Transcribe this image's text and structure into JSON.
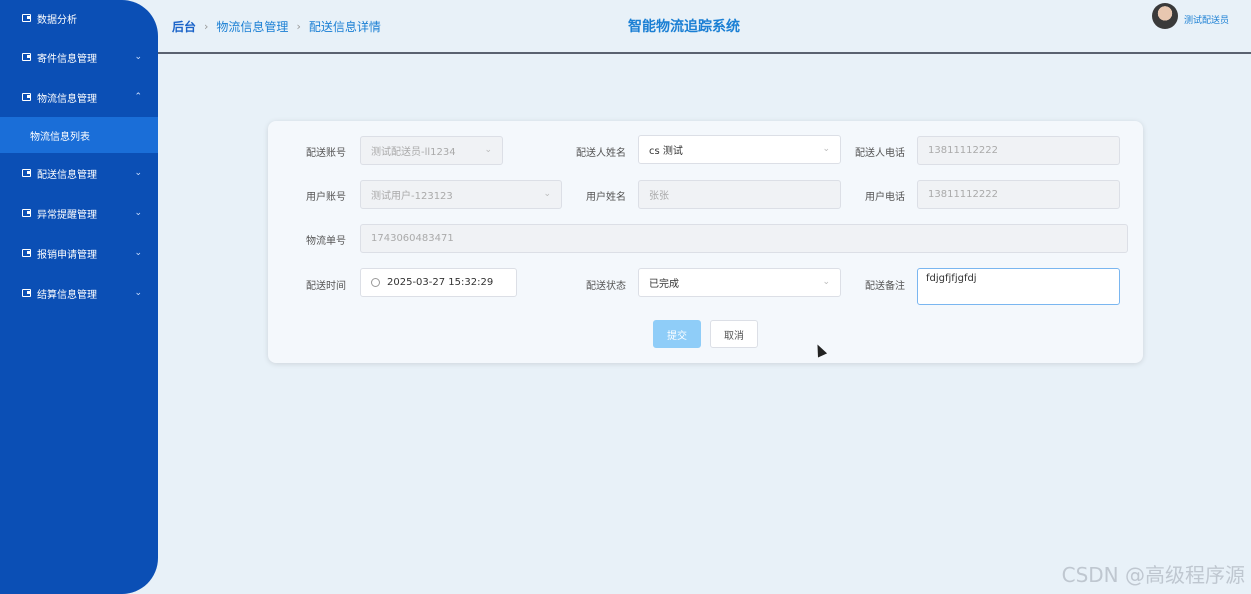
{
  "sidebar": {
    "items": [
      {
        "label": "数据分析",
        "chevron": ""
      },
      {
        "label": "寄件信息管理",
        "chevron": "⌄"
      },
      {
        "label": "物流信息管理",
        "chevron": "⌃"
      },
      {
        "label": "物流信息列表",
        "chevron": ""
      },
      {
        "label": "配送信息管理",
        "chevron": "⌄"
      },
      {
        "label": "异常提醒管理",
        "chevron": "⌄"
      },
      {
        "label": "报销申请管理",
        "chevron": "⌄"
      },
      {
        "label": "结算信息管理",
        "chevron": "⌄"
      }
    ]
  },
  "header": {
    "breadcrumb": {
      "home": "后台",
      "level1": "物流信息管理",
      "level2": "配送信息详情",
      "sep": "›"
    },
    "system_title": "智能物流追踪系统",
    "user_name": "测试配送员"
  },
  "form": {
    "row1": {
      "account_label": "配送账号",
      "account_value": "测试配送员-ll1234",
      "name_label": "配送人姓名",
      "name_value": "cs 测试",
      "phone_label": "配送人电话",
      "phone_value": "13811112222"
    },
    "row2": {
      "user_account_label": "用户账号",
      "user_account_value": "测试用户-123123",
      "user_name_label": "用户姓名",
      "user_name_value": "张张",
      "user_phone_label": "用户电话",
      "user_phone_value": "13811112222"
    },
    "row3": {
      "tracking_label": "物流单号",
      "tracking_value": "1743060483471"
    },
    "row4": {
      "time_label": "配送时间",
      "time_value": "2025-03-27 15:32:29",
      "status_label": "配送状态",
      "status_value": "已完成",
      "remark_label": "配送备注",
      "remark_value": "fdjgfjfjgfdj"
    },
    "buttons": {
      "submit": "提交",
      "cancel": "取消"
    }
  },
  "watermark": "CSDN @高级程序源"
}
